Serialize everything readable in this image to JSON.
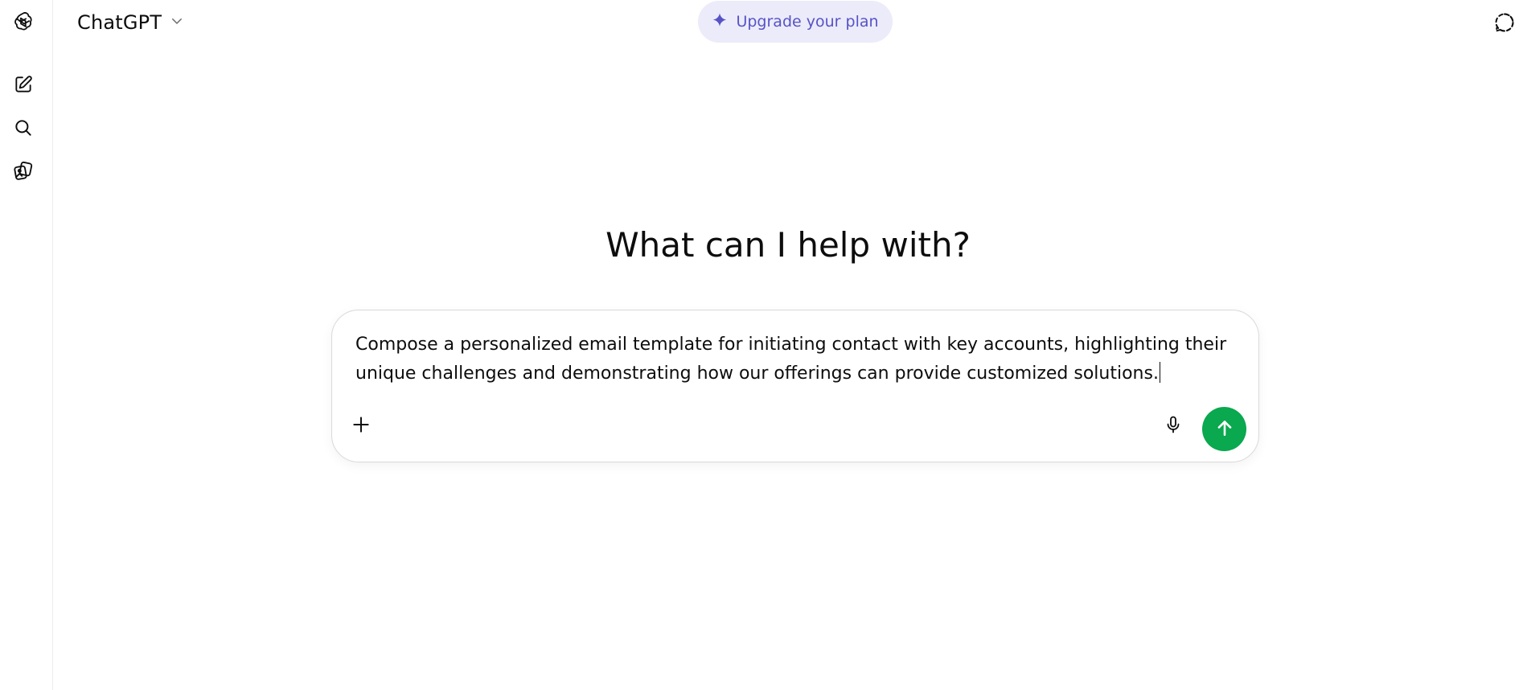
{
  "app": {
    "model_name": "ChatGPT"
  },
  "header": {
    "upgrade_label": "Upgrade your plan"
  },
  "main": {
    "heading": "What can I help with?",
    "composer_text": "Compose a personalized email template for initiating contact with key accounts, highlighting their unique challenges and demonstrating how our offerings can provide customized solutions."
  },
  "icons": {
    "logo": "openai-logo-icon",
    "new_chat": "new-chat-icon",
    "search": "search-icon",
    "library": "library-icon",
    "model_dropdown": "chevron-down-icon",
    "upgrade": "sparkle-icon",
    "temporary_chat": "temporary-chat-icon",
    "attach": "plus-icon",
    "dictate": "microphone-icon",
    "send": "arrow-up-icon"
  },
  "colors": {
    "upgrade_bg": "#ecebfa",
    "upgrade_text": "#5653c6",
    "send_button": "#0aa84f",
    "text": "#0d0d0d",
    "border": "#d9d9d9"
  }
}
